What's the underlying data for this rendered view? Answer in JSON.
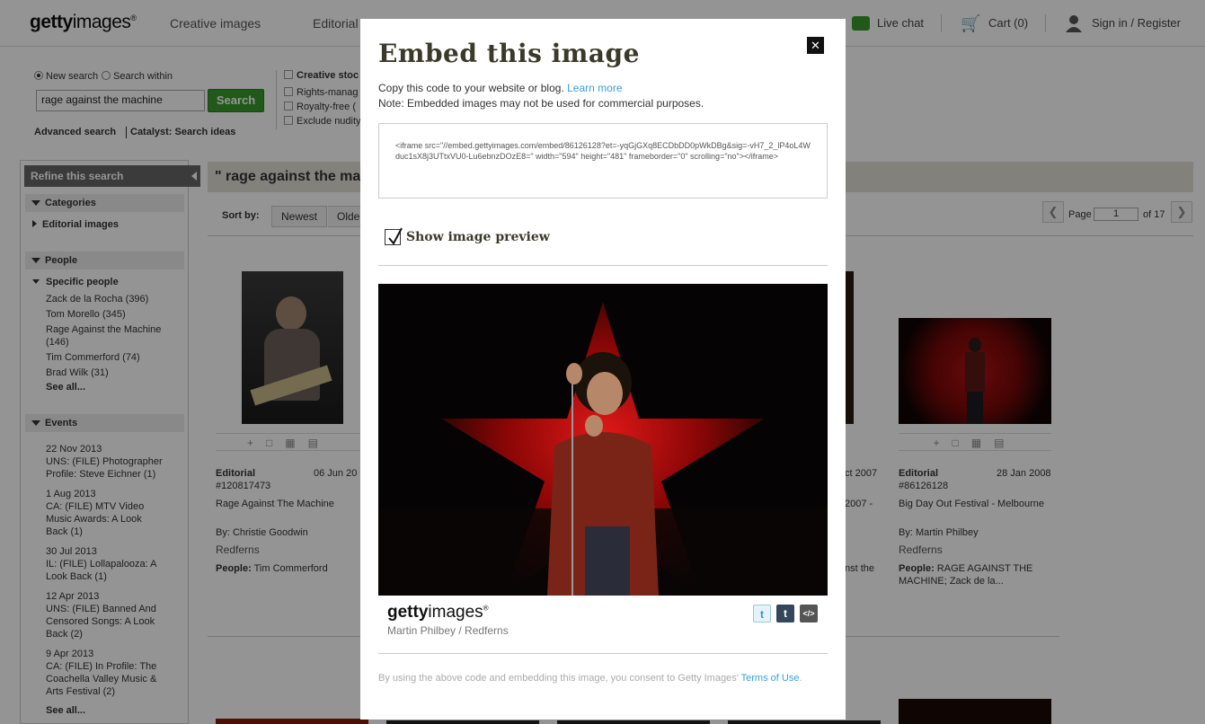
{
  "header": {
    "logo_bold": "getty",
    "logo_light": "images",
    "logo_reg": "®",
    "nav": [
      "Creative images",
      "Editorial"
    ],
    "live_chat": "Live chat",
    "cart": "Cart (0)",
    "sign_in": "Sign in / Register"
  },
  "search": {
    "new_search": "New search",
    "search_within": "Search within",
    "query": "rage against the machine",
    "button": "Search",
    "advanced": "Advanced search",
    "catalyst": "Catalyst: Search ideas",
    "filter_creative": "Creative stoc",
    "filter_rights": "Rights-manag",
    "filter_royalty": "Royalty-free (",
    "filter_nudity": "Exclude nudity"
  },
  "sidebar": {
    "refine": "Refine this search",
    "categories": "Categories",
    "editorial": "Editorial images",
    "people": "People",
    "specific_people": "Specific people",
    "people_items": [
      "Zack de la Rocha (396)",
      "Tom Morello (345)",
      "Rage Against the Machine (146)",
      "Tim Commerford (74)",
      "Brad Wilk (31)"
    ],
    "see_all": "See all...",
    "events": "Events",
    "event_items": [
      {
        "date": "22 Nov 2013",
        "text": "UNS: (FILE) Photographer Profile: Steve Eichner (1)"
      },
      {
        "date": "1 Aug 2013",
        "text": "CA: (FILE) MTV Video Music Awards: A Look Back (1)"
      },
      {
        "date": "30 Jul 2013",
        "text": "IL: (FILE) Lollapalooza: A Look Back (1)"
      },
      {
        "date": "12 Apr 2013",
        "text": "UNS: (FILE) Banned And Censored Songs: A Look Back (2)"
      },
      {
        "date": "9 Apr 2013",
        "text": "CA: (FILE) In Profile: The Coachella Valley Music & Arts Festival (2)"
      }
    ],
    "see_all_events": "See all..."
  },
  "results": {
    "title": "\" rage against the mac",
    "sort_by": "Sort by:",
    "sort_newest": "Newest",
    "sort_oldest": "Olde",
    "page_label": "Page",
    "page_value": "1",
    "page_of": "of 17",
    "card1": {
      "type": "Editorial",
      "date": "06 Jun 20",
      "id": "#120817473",
      "title": "Rage Against The Machine",
      "by": "By: Christie Goodwin",
      "source": "Redferns",
      "people_label": "People:",
      "people": "Tim Commerford"
    },
    "card2": {
      "date": "ct 2007",
      "title": "2007 -",
      "people": "nst the"
    },
    "card3": {
      "type": "Editorial",
      "date": "28 Jan 2008",
      "id": "#86126128",
      "title": "Big Day Out Festival - Melbourne",
      "by": "By: Martin Philbey",
      "source": "Redferns",
      "people_label": "People:",
      "people": "RAGE AGAINST THE MACHINE; Zack de la..."
    }
  },
  "modal": {
    "title": "Embed this image",
    "instruction": "Copy this code to your website or blog.",
    "learn_more": "Learn more",
    "note": "Note: Embedded images may not be used for commercial purposes.",
    "embed_code": "<iframe src=\"//embed.gettyimages.com/embed/86126128?et=-yqGjGXq8ECDbDD0pWkDBg&sig=-vH7_2_lP4oL4Wduc1sX8j3UTtxVU0-Lu6ebnzDOzE8=\" width=\"594\" height=\"481\" frameborder=\"0\" scrolling=\"no\"></iframe>",
    "show_preview": "Show image preview",
    "preview_checked": true,
    "credit": "Martin Philbey / Redferns",
    "share_twitter": "t",
    "share_tumblr": "t",
    "share_embed": "</>",
    "terms_prefix": "By using the above code and embedding this image, you consent to Getty Images'",
    "terms_link": "Terms of Use",
    "terms_suffix": "."
  },
  "colors": {
    "accent_link": "#3aa0d8",
    "search_button": "#3a9a2e",
    "title": "#3b3a2a"
  }
}
